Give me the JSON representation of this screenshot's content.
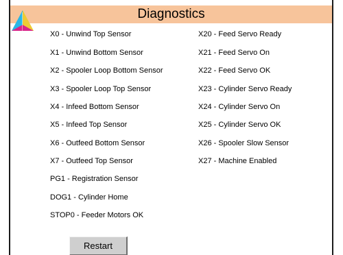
{
  "header": {
    "title": "Diagnostics"
  },
  "colors": {
    "title_bar": "#f7c49b",
    "logo_yellow": "#f2d33a",
    "logo_cyan": "#29b6e8",
    "logo_magenta": "#d9258a"
  },
  "icons": {
    "logo": "tri-color-triangle-logo"
  },
  "left_column": [
    "X0 - Unwind Top Sensor",
    "X1 - Unwind Bottom Sensor",
    "X2 - Spooler Loop Bottom Sensor",
    "X3 - Spooler Loop Top Sensor",
    "X4 - Infeed Bottom Sensor",
    "X5 - Infeed Top Sensor",
    "X6 - Outfeed Bottom Sensor",
    "X7 - Outfeed Top Sensor",
    "PG1 - Registration Sensor",
    "DOG1 - Cylinder Home",
    "STOP0 - Feeder Motors OK"
  ],
  "right_column": [
    "X20 - Feed Servo Ready",
    "X21 - Feed Servo On",
    "X22 - Feed Servo OK",
    "X23 - Cylinder Servo Ready",
    "X24 - Cylinder Servo On",
    "X25 - Cylinder Servo OK",
    "X26 - Spooler Slow Sensor",
    "X27 - Machine Enabled"
  ],
  "actions": {
    "restart_label": "Restart"
  }
}
